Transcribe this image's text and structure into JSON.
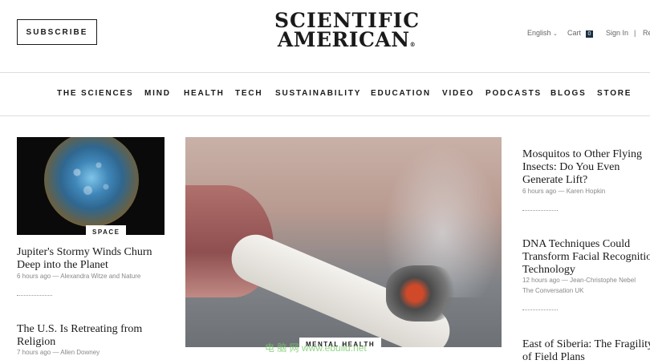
{
  "header": {
    "subscribe_label": "SUBSCRIBE",
    "logo_line1": "SCIENTIFIC",
    "logo_line2": "AMERICAN",
    "logo_mark": "®",
    "language": "English",
    "cart_label": "Cart",
    "cart_count": "0",
    "signin_label": "Sign In",
    "separator": "|",
    "register_label": "Re"
  },
  "nav": {
    "items": [
      "THE SCIENCES",
      "MIND",
      "HEALTH",
      "TECH",
      "SUSTAINABILITY",
      "EDUCATION",
      "VIDEO",
      "PODCASTS",
      "BLOGS",
      "STORE"
    ]
  },
  "left_column": {
    "card1": {
      "tag": "SPACE",
      "headline": "Jupiter's Stormy Winds Churn Deep into the Planet",
      "meta": "6 hours ago — Alexandra Witze and Nature"
    },
    "card2": {
      "headline": "The U.S. Is Retreating from Religion",
      "meta": "7 hours ago — Allen Downey"
    }
  },
  "hero": {
    "tag": "MENTAL HEALTH"
  },
  "right_column": {
    "items": [
      {
        "headline": "Mosquitos to Other Flying Insects: Do You Even Generate Lift?",
        "meta": "6 hours ago — Karen Hopkin"
      },
      {
        "headline": "DNA Techniques Could Transform Facial Recognition Technology",
        "meta": "12 hours ago — Jean-Christophe Nebel",
        "meta2": "The Conversation UK"
      },
      {
        "headline": "East of Siberia: The Fragility of Field Plans"
      }
    ]
  },
  "watermark": "电 脑 网 www.ebuild.net",
  "colors": {
    "accent": "#1a2f44",
    "text": "#1a1a1a",
    "muted": "#888888"
  }
}
